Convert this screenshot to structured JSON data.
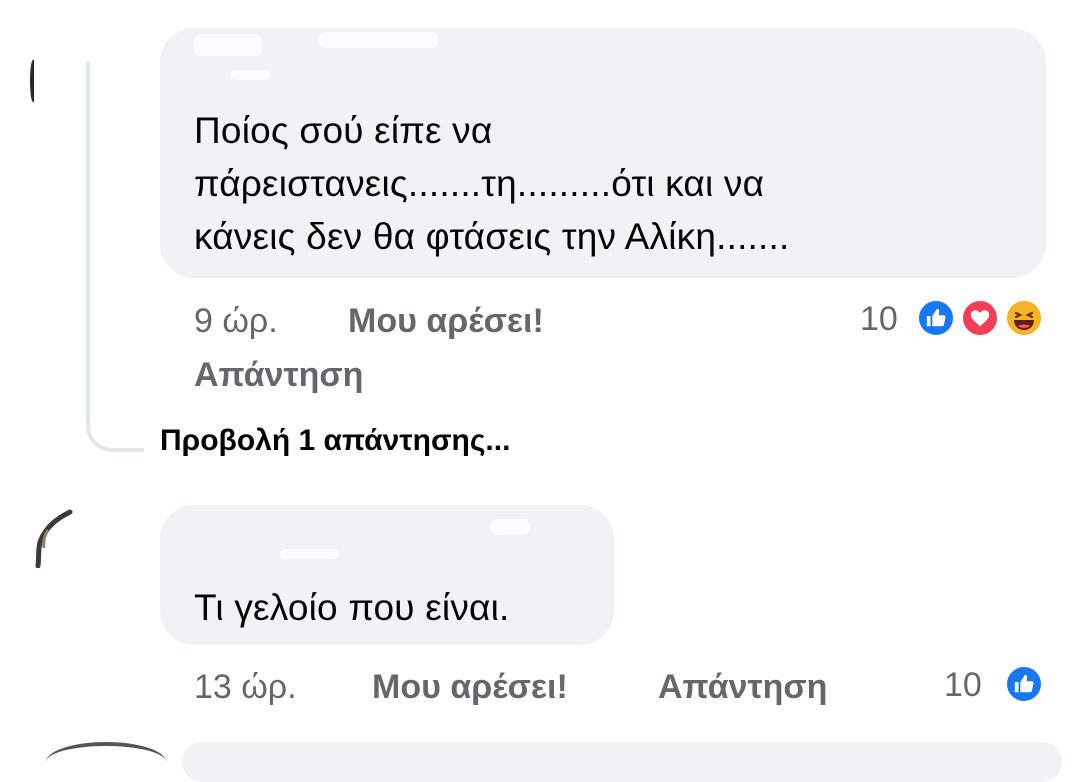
{
  "colors": {
    "bubble": "#f0f2f5",
    "meta_text": "#65676b",
    "like": "#1877f2",
    "love": "#f33e58",
    "haha": "#f7b125"
  },
  "comments": [
    {
      "text": "Ποίος σού είπε να\nπάρειστανεις.......τη.........ότι και να\nκάνεις δεν θα φτάσεις την Αλίκη.......",
      "time": "9 ώρ.",
      "like_label": "Μου αρέσει!",
      "reply_label": "Απάντηση",
      "reaction_count": "10",
      "reactions": [
        "like-icon",
        "love-icon",
        "haha-icon"
      ],
      "view_replies": "Προβολή 1 απάντησης..."
    },
    {
      "text": "Τι γελοίο που είναι.",
      "time": "13 ώρ.",
      "like_label": "Μου αρέσει!",
      "reply_label": "Απάντηση",
      "reaction_count": "10",
      "reactions": [
        "like-icon"
      ]
    }
  ]
}
